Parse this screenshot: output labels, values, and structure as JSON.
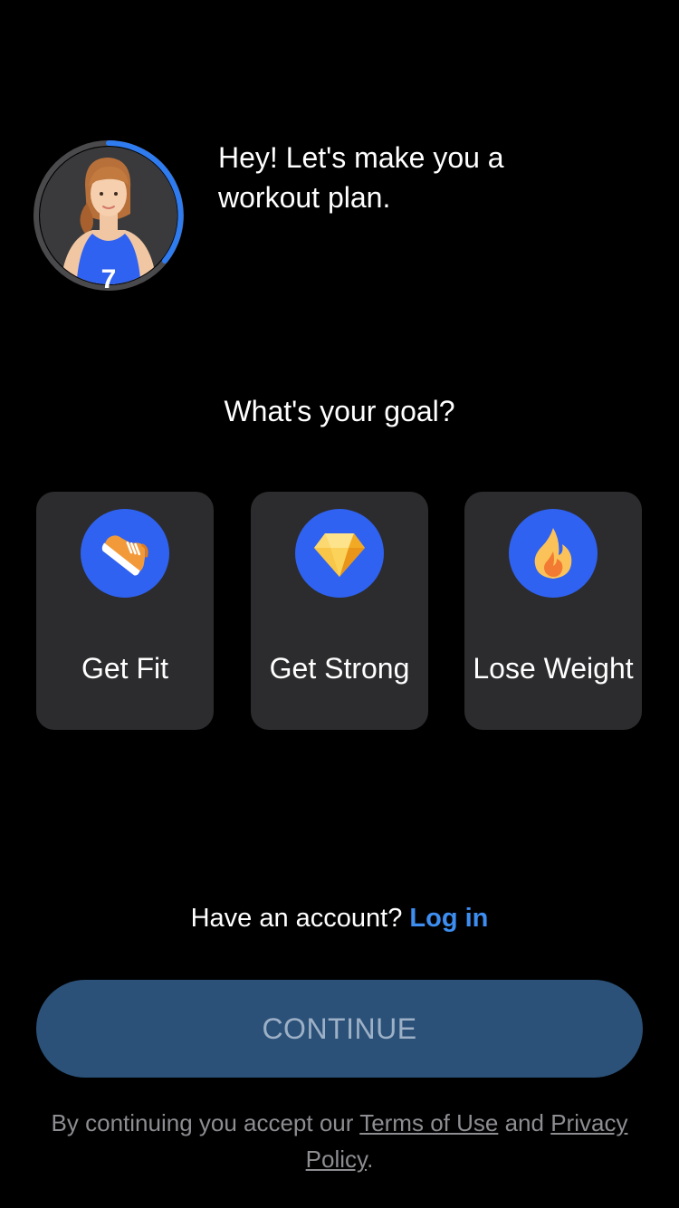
{
  "coach": {
    "greeting": "Hey! Let's make you a workout plan.",
    "avatar_icon": "coach-avatar",
    "shirt_number": "7",
    "ring_color": "#2f7bf0"
  },
  "goal": {
    "question": "What's your goal?",
    "options": [
      {
        "label": "Get Fit",
        "icon": "sneaker-icon"
      },
      {
        "label": "Get Strong",
        "icon": "diamond-icon"
      },
      {
        "label": "Lose Weight",
        "icon": "flame-icon"
      }
    ]
  },
  "account": {
    "prompt": "Have an account?",
    "login_label": "Log in"
  },
  "continue_button": {
    "label": "CONTINUE"
  },
  "legal": {
    "prefix": "By continuing you accept our",
    "terms_label": "Terms of Use",
    "conjunction": "and",
    "privacy_label": "Privacy Policy",
    "suffix": "."
  },
  "colors": {
    "accent": "#3d8ef0",
    "icon_bg": "#2f62f0",
    "card_bg": "#2c2c2e",
    "button_bg": "#2b5178"
  }
}
